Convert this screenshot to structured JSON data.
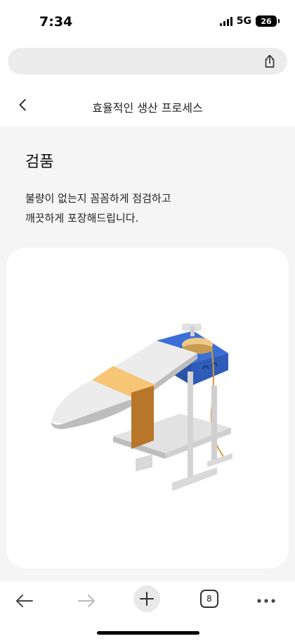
{
  "status_bar": {
    "time": "7:34",
    "network": "5G",
    "battery": "26"
  },
  "browser": {
    "url_placeholder": "",
    "share_icon": "share-icon"
  },
  "nav": {
    "title": "효율적인 생산 프로세스",
    "back_icon": "chevron-left-icon"
  },
  "section": {
    "title": "검품",
    "description_line1": "불량이 없는지 꼼꼼하게 점검하고",
    "description_line2": "깨끗하게 포장해드립니다."
  },
  "illustration": {
    "subject": "ironing-board-illustration",
    "colors": {
      "board": "#ececec",
      "board_edge": "#bdbdbd",
      "cloth_band": "#f6c676",
      "cloth_hang": "#b8762a",
      "station": "#3a6fd6",
      "iron": "#f0c987",
      "cord": "#d89a3c"
    }
  },
  "toolbar": {
    "back_icon": "arrow-left-icon",
    "forward_icon": "arrow-right-icon",
    "new_tab_icon": "plus-icon",
    "tabs_count": "8",
    "more_icon": "more-icon"
  },
  "colors": {
    "page_bg": "#f5f5f5",
    "card_bg": "#ffffff",
    "url_bar_bg": "#ececec"
  }
}
